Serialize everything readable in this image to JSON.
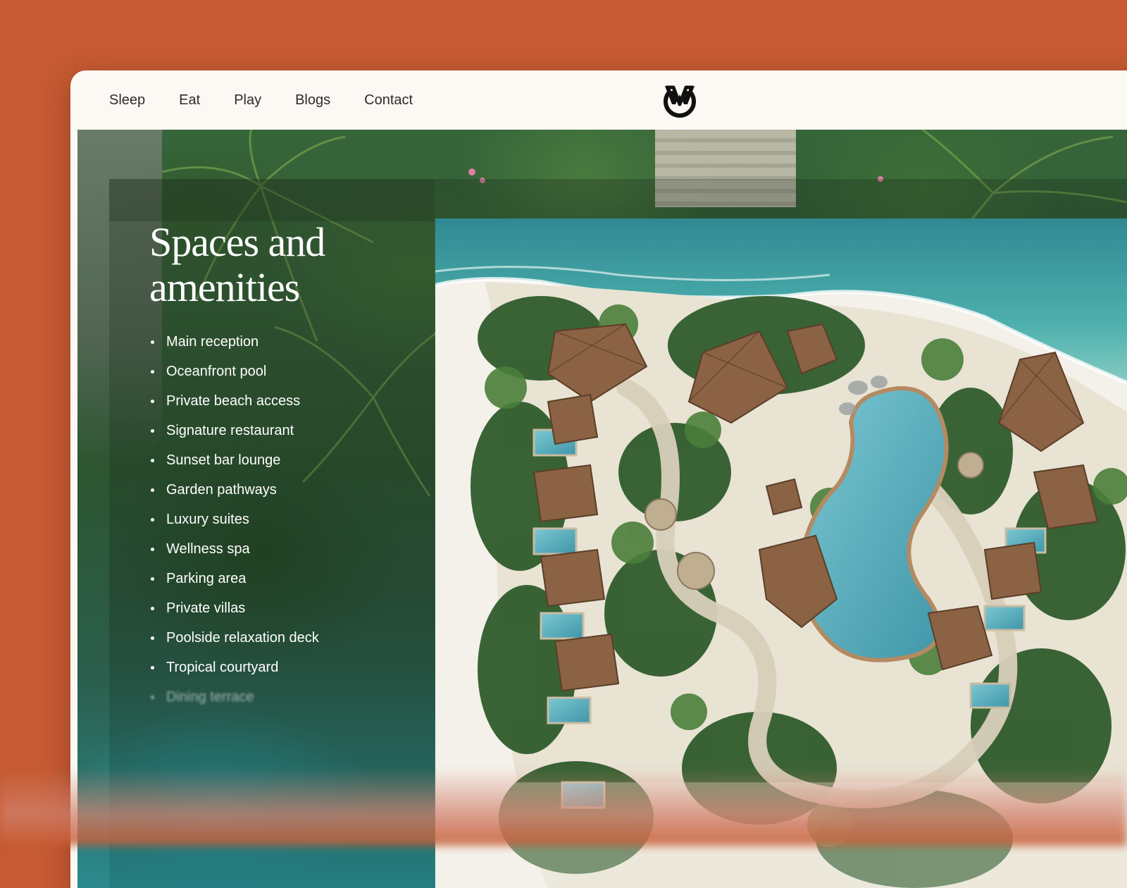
{
  "nav": {
    "items": [
      {
        "label": "Sleep"
      },
      {
        "label": "Eat"
      },
      {
        "label": "Play"
      },
      {
        "label": "Blogs"
      },
      {
        "label": "Contact"
      }
    ],
    "logo_icon": "m-monogram-logo"
  },
  "hero": {
    "title": "Spaces and amenities",
    "amenities": [
      "Main reception",
      "Oceanfront pool",
      "Private beach access",
      "Signature restaurant",
      "Sunset bar lounge",
      "Garden pathways",
      "Luxury suites",
      "Wellness spa",
      "Parking area",
      "Private villas",
      "Poolside relaxation deck",
      "Tropical courtyard",
      "Dining terrace"
    ]
  },
  "colors": {
    "background": "#c65a32",
    "window": "#fcf8f3",
    "ocean": "#3a9aa0",
    "pool": "#5fb3c4",
    "foliage": "#2f5a2c",
    "roof": "#8b6244"
  }
}
